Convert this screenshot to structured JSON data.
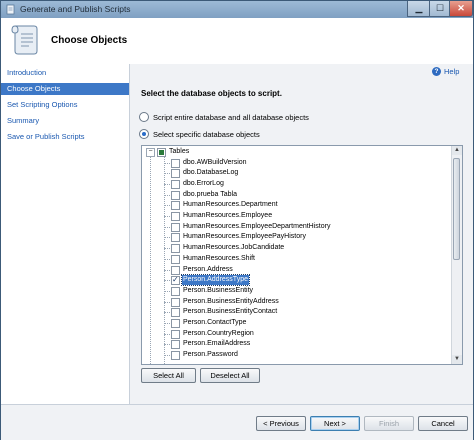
{
  "window": {
    "title": "Generate and Publish Scripts"
  },
  "header": {
    "title": "Choose Objects"
  },
  "nav": {
    "items": [
      {
        "label": "Introduction",
        "active": false
      },
      {
        "label": "Choose Objects",
        "active": true
      },
      {
        "label": "Set Scripting Options",
        "active": false
      },
      {
        "label": "Summary",
        "active": false
      },
      {
        "label": "Save or Publish Scripts",
        "active": false
      }
    ]
  },
  "help": {
    "label": "Help"
  },
  "main": {
    "instruction": "Select the database objects to script.",
    "radio_entire": "Script entire database and all database objects",
    "radio_specific": "Select specific database objects",
    "selected_option": "specific"
  },
  "tree": {
    "root": "Tables",
    "items": [
      "dbo.AWBuildVersion",
      "dbo.DatabaseLog",
      "dbo.ErrorLog",
      "dbo.prueba Tabla",
      "HumanResources.Department",
      "HumanResources.Employee",
      "HumanResources.EmployeeDepartmentHistory",
      "HumanResources.EmployeePayHistory",
      "HumanResources.JobCandidate",
      "HumanResources.Shift",
      "Person.Address",
      "Person.AddressType",
      "Person.BusinessEntity",
      "Person.BusinessEntityAddress",
      "Person.BusinessEntityContact",
      "Person.ContactType",
      "Person.CountryRegion",
      "Person.EmailAddress",
      "Person.Password"
    ],
    "checked_item": "Person.AddressType"
  },
  "buttons": {
    "select_all": "Select All",
    "deselect_all": "Deselect All",
    "previous": "< Previous",
    "next": "Next >",
    "finish": "Finish",
    "cancel": "Cancel"
  }
}
